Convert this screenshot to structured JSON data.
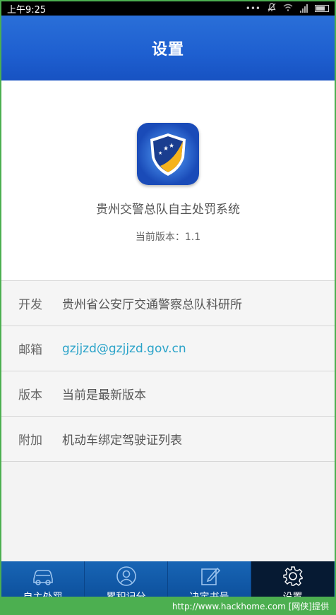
{
  "status_bar": {
    "time": "上午9:25",
    "icons": [
      "more-dots-icon",
      "bell-muted-icon",
      "wifi-icon",
      "signal-icon",
      "battery-icon"
    ]
  },
  "header": {
    "title": "设置"
  },
  "app": {
    "name": "贵州交警总队自主处罚系统",
    "version": "当前版本：1.1"
  },
  "info_rows": [
    {
      "label": "开发",
      "value": "贵州省公安厅交通警察总队科研所"
    },
    {
      "label": "邮箱",
      "value": "gzjjzd@gzjjzd.gov.cn"
    },
    {
      "label": "版本",
      "value": "当前是最新版本"
    },
    {
      "label": "附加",
      "value": "机动车绑定驾驶证列表"
    }
  ],
  "bottom_nav": {
    "items": [
      {
        "label": "自主处罚",
        "icon": "car-icon"
      },
      {
        "label": "累积记分",
        "icon": "user-icon"
      },
      {
        "label": "决定书号",
        "icon": "edit-icon"
      },
      {
        "label": "设置",
        "icon": "gear-icon",
        "active": true
      }
    ]
  },
  "watermark": "http://www.hackhome.com [网侠]提供",
  "colors": {
    "header": "#1e5fd0",
    "nav": "#0d58a8",
    "link": "#2aa3c9",
    "frame": "#4caf50"
  }
}
